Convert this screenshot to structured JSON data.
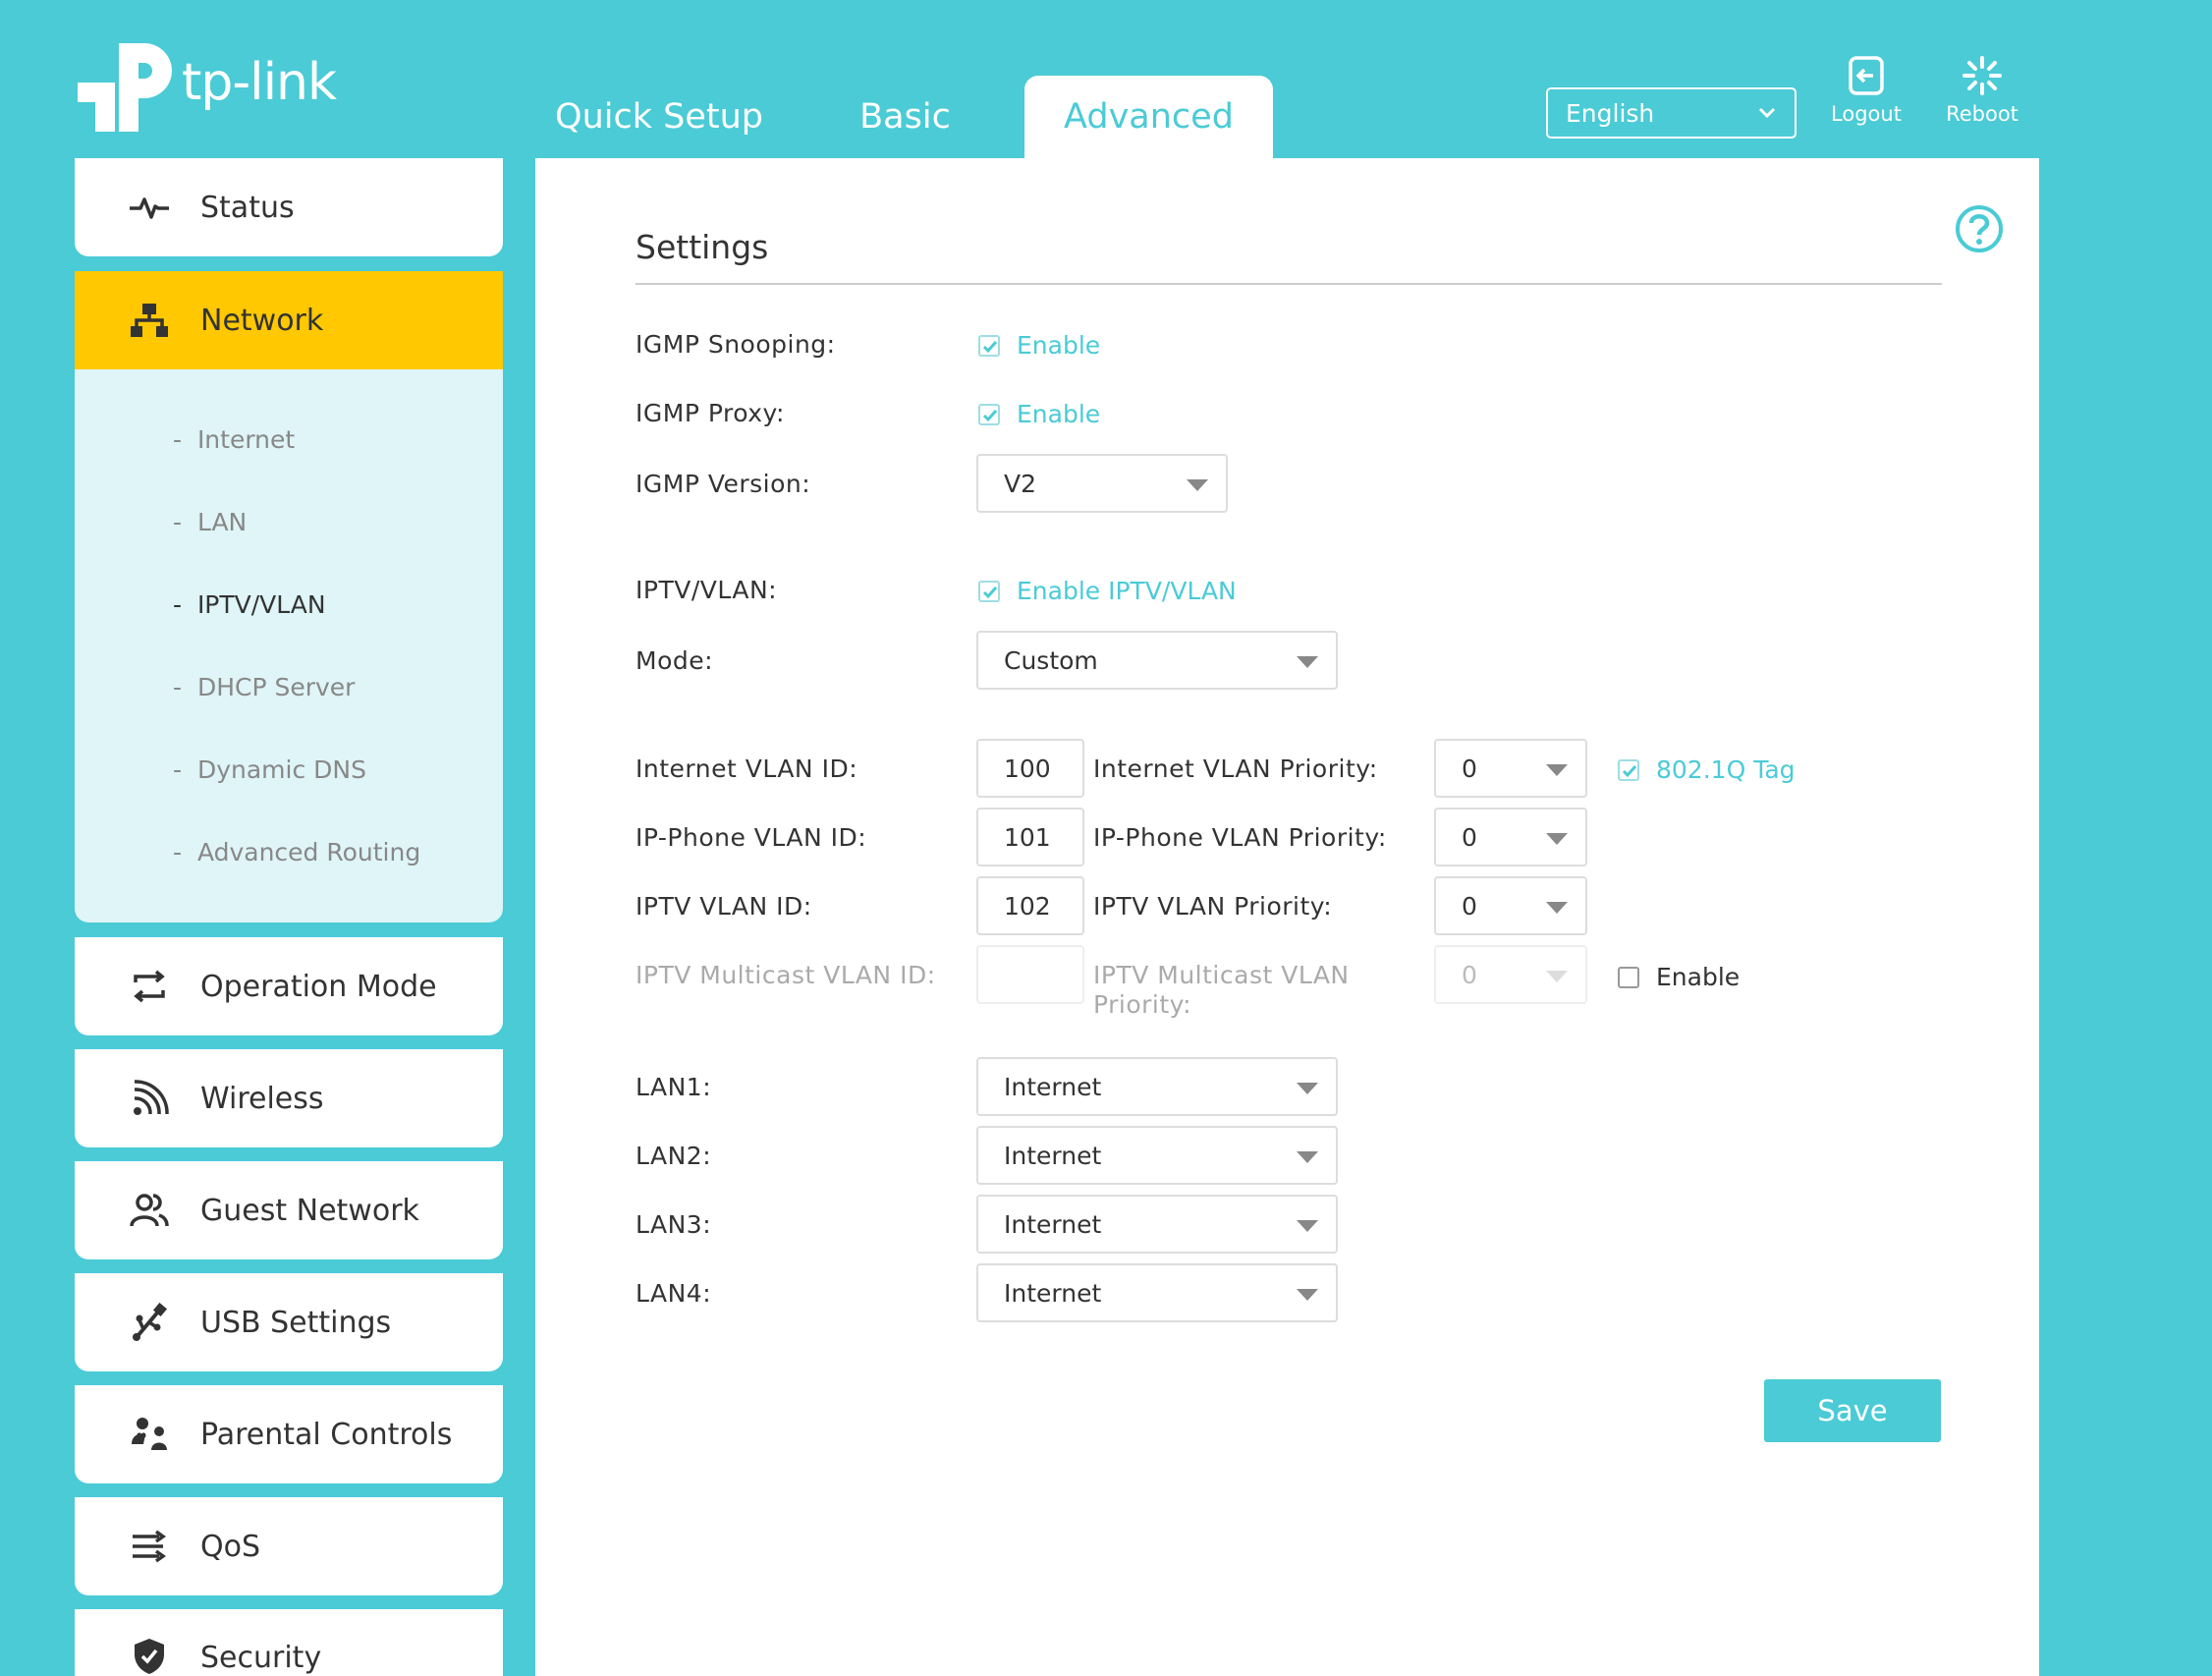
{
  "brand": {
    "name": "tp-link"
  },
  "tabs": [
    {
      "label": "Quick Setup"
    },
    {
      "label": "Basic"
    },
    {
      "label": "Advanced",
      "active": true
    }
  ],
  "header": {
    "language": "English",
    "logout_label": "Logout",
    "reboot_label": "Reboot"
  },
  "sidebar": {
    "items": [
      {
        "label": "Status",
        "icon": "pulse-icon"
      },
      {
        "label": "Network",
        "icon": "network-icon",
        "active": true
      },
      {
        "label": "Operation Mode",
        "icon": "operation-mode-icon"
      },
      {
        "label": "Wireless",
        "icon": "wireless-icon"
      },
      {
        "label": "Guest Network",
        "icon": "guest-network-icon"
      },
      {
        "label": "USB Settings",
        "icon": "usb-icon"
      },
      {
        "label": "Parental Controls",
        "icon": "parental-controls-icon"
      },
      {
        "label": "QoS",
        "icon": "qos-icon"
      },
      {
        "label": "Security",
        "icon": "shield-icon"
      }
    ],
    "network_sub": [
      {
        "label": "Internet"
      },
      {
        "label": "LAN"
      },
      {
        "label": "IPTV/VLAN",
        "current": true
      },
      {
        "label": "DHCP Server"
      },
      {
        "label": "Dynamic DNS"
      },
      {
        "label": "Advanced Routing"
      }
    ],
    "sub_prefix": "-"
  },
  "settings": {
    "title": "Settings",
    "igmp_snooping": {
      "label": "IGMP Snooping:",
      "checkbox_label": "Enable",
      "checked": true
    },
    "igmp_proxy": {
      "label": "IGMP Proxy:",
      "checkbox_label": "Enable",
      "checked": true
    },
    "igmp_version": {
      "label": "IGMP Version:",
      "value": "V2"
    },
    "iptv_vlan": {
      "label": "IPTV/VLAN:",
      "checkbox_label": "Enable IPTV/VLAN",
      "checked": true
    },
    "mode": {
      "label": "Mode:",
      "value": "Custom"
    },
    "internet_vlan": {
      "label": "Internet VLAN ID:",
      "id": "100",
      "priority_label": "Internet VLAN Priority:",
      "priority": "0",
      "tag_label": "802.1Q Tag",
      "tag_checked": true
    },
    "ipphone_vlan": {
      "label": "IP-Phone VLAN ID:",
      "id": "101",
      "priority_label": "IP-Phone VLAN Priority:",
      "priority": "0"
    },
    "iptv_vlan_id": {
      "label": "IPTV VLAN ID:",
      "id": "102",
      "priority_label": "IPTV VLAN Priority:",
      "priority": "0"
    },
    "multicast_vlan": {
      "label": "IPTV Multicast VLAN ID:",
      "id": "",
      "priority_label_1": "IPTV Multicast VLAN",
      "priority_label_2": "Priority:",
      "priority": "0",
      "enable_label": "Enable",
      "enable_checked": false
    },
    "lan": [
      {
        "label": "LAN1:",
        "value": "Internet"
      },
      {
        "label": "LAN2:",
        "value": "Internet"
      },
      {
        "label": "LAN3:",
        "value": "Internet"
      },
      {
        "label": "LAN4:",
        "value": "Internet"
      }
    ],
    "save_label": "Save"
  },
  "colors": {
    "accent": "#4acbd6",
    "active_nav": "#ffc800",
    "sub_panel": "#dff5f7"
  }
}
